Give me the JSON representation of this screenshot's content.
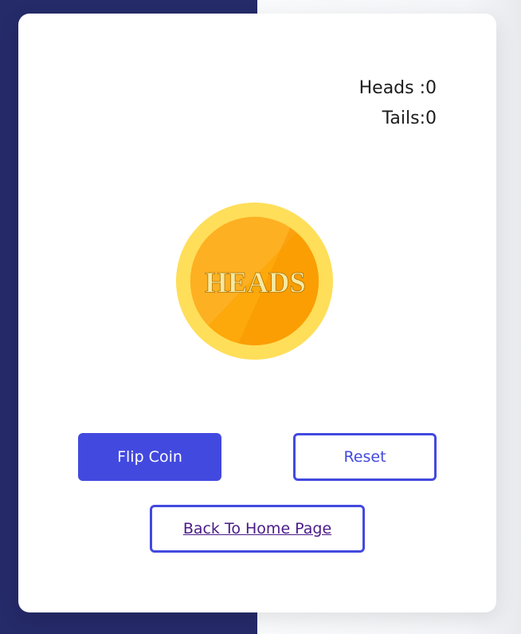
{
  "scoreboard": {
    "heads_label": "Heads :0",
    "tails_label": "Tails:0"
  },
  "coin": {
    "face_text": "HEADS"
  },
  "buttons": {
    "flip_label": "Flip Coin",
    "reset_label": "Reset",
    "home_label": "Back To Home Page"
  },
  "colors": {
    "sidebar_dark": "#252a69",
    "accent": "#4249df",
    "coin_outer": "#ffdd55",
    "coin_inner": "#ffa800"
  }
}
